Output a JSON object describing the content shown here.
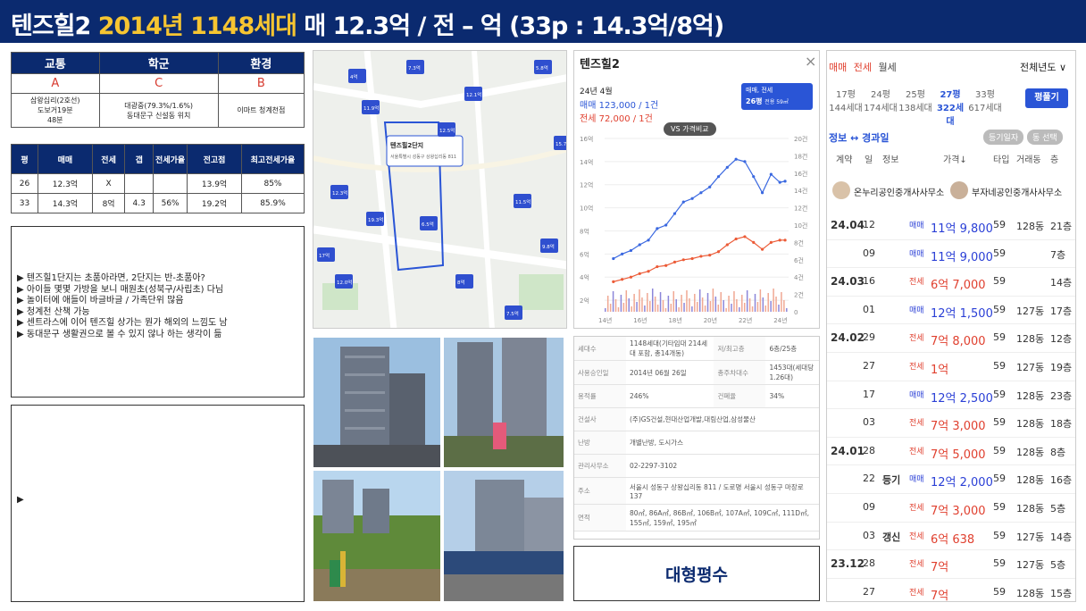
{
  "header": {
    "name": "텐즈힐2",
    "year_units": "2014년 1148세대",
    "rest": "매 12.3억 / 전 – 억 (33p : 14.3억/8억)"
  },
  "env_table": {
    "headers": [
      "교통",
      "학군",
      "환경"
    ],
    "grades": [
      "A",
      "C",
      "B"
    ],
    "details": [
      [
        "삼왕십리(2호선)",
        "도보거19분",
        "48분"
      ],
      [
        "대광중(79.3%/1.6%)",
        "동대문구 신설동 위치"
      ],
      [
        "이마트 청계천점"
      ]
    ]
  },
  "price_table": {
    "headers": [
      "평",
      "매매",
      "전세",
      "갭",
      "전세가율",
      "전고점",
      "최고전세가율"
    ],
    "rows": [
      [
        "26",
        "12.3억",
        "X",
        "",
        "",
        "13.9억",
        "85%"
      ],
      [
        "33",
        "14.3억",
        "8억",
        "4.3",
        "56%",
        "19.2억",
        "85.9%"
      ]
    ]
  },
  "notes": [
    "▶ 텐즈힐1단지는 초품아라면, 2단지는 반-초품아?",
    "▶ 아이들 몇몇 가방을 보니 매원초(성북구/사립초) 다님",
    "▶ 놀이터에 애들이 바글바글 / 가족단위 많음",
    "▶ 청계천 산책 가능",
    "▶ 센트라스에 이어 텐즈힐 상가는 뭔가 해외의 느낌도 남",
    "▶ 동대문구 생활권으로 볼 수 있지 않나 하는 생각이 듦"
  ],
  "notes2": [
    "▶"
  ],
  "map": {
    "popup_title": "텐즈힐2단지",
    "popup_sub": "서울특별시 성동구 상왕십리동 811",
    "pin_labels": [
      "7.3억",
      "5.8억",
      "12.1억",
      "11.9억",
      "12.5억",
      "15.7억",
      "12.3억",
      "11.5억",
      "19.3억",
      "6.5억",
      "9.8억",
      "12.0억",
      "8억",
      "7.5억",
      "4억",
      "17억"
    ]
  },
  "chart_panel": {
    "title": "텐즈힐2",
    "close": "×",
    "date": "24년 4월",
    "sale": "매매 123,000 / 1건",
    "jeonse": "전세 72,000 / 1건",
    "dropdown": "매매, 전세",
    "size": "26평",
    "size_sub": "전용 59㎡",
    "compare": "VS 가격비교"
  },
  "chart_data": {
    "type": "line",
    "x_ticks": [
      "14년",
      "16년",
      "18년",
      "20년",
      "22년",
      "24년"
    ],
    "y_ticks_left": [
      "16억",
      "14억",
      "12억",
      "10억",
      "8억",
      "6억",
      "4억",
      "2억"
    ],
    "y_ticks_right": [
      "20건",
      "18건",
      "16건",
      "14건",
      "12건",
      "10건",
      "8건",
      "6건",
      "4건",
      "2건",
      "0"
    ],
    "series": [
      {
        "name": "매매",
        "x": [
          2014.5,
          2015,
          2015.5,
          2016,
          2016.5,
          2017,
          2017.5,
          2018,
          2018.5,
          2019,
          2019.5,
          2020,
          2020.5,
          2021,
          2021.5,
          2022,
          2022.5,
          2023,
          2023.5,
          2024,
          2024.3
        ],
        "values": [
          5.6,
          6.0,
          6.3,
          6.8,
          7.2,
          8.2,
          8.5,
          9.5,
          10.5,
          10.8,
          11.3,
          11.8,
          12.7,
          13.5,
          14.2,
          14.0,
          12.7,
          11.3,
          12.9,
          12.2,
          12.3
        ]
      },
      {
        "name": "전세",
        "x": [
          2014.5,
          2015,
          2015.5,
          2016,
          2016.5,
          2017,
          2017.5,
          2018,
          2018.5,
          2019,
          2019.5,
          2020,
          2020.5,
          2021,
          2021.5,
          2022,
          2022.5,
          2023,
          2023.5,
          2024,
          2024.3
        ],
        "values": [
          3.6,
          3.8,
          4.0,
          4.3,
          4.5,
          4.9,
          5.0,
          5.3,
          5.5,
          5.6,
          5.8,
          5.9,
          6.2,
          6.8,
          7.3,
          7.5,
          7.0,
          6.4,
          7.0,
          7.2,
          7.2
        ]
      }
    ]
  },
  "info": [
    [
      "세대수",
      "1148세대(기타임대 214세대 포함, 총14개동)",
      "저/최고층",
      "6층/25층"
    ],
    [
      "사용승인일",
      "2014년 06월 26일",
      "총주차대수",
      "1453대(세대당 1.26대)"
    ],
    [
      "용적률",
      "246%",
      "건폐율",
      "34%"
    ],
    [
      "건설사",
      "(주)GS건설,현대산업개발,대림산업,삼성물산",
      "",
      ""
    ],
    [
      "난방",
      "개별난방, 도시가스",
      "",
      ""
    ],
    [
      "관리사무소",
      "02-2297-3102",
      "",
      ""
    ],
    [
      "주소",
      "서울시 성동구 상왕십리동 811 / 도로명 서울시 성동구 마장로 137",
      "",
      ""
    ],
    [
      "면적",
      "80㎡, 86A㎡, 86B㎡, 106B㎡, 107A㎡, 109C㎡, 111D㎡, 155㎡, 159㎡, 195㎡",
      "",
      ""
    ]
  ],
  "big_label": "대형평수",
  "deals": {
    "tabs": [
      "매매",
      "전세",
      "월세"
    ],
    "period": "전체년도 ∨",
    "sizes": [
      [
        "17평",
        "144세대"
      ],
      [
        "24평",
        "174세대"
      ],
      [
        "25평",
        "138세대"
      ],
      [
        "27평",
        "322세대"
      ],
      [
        "33평",
        "617세대"
      ]
    ],
    "compare_btn": "평풀기",
    "sub_tabs": [
      "정보 ↔ 경과일"
    ],
    "badges": [
      "등기일자",
      "동 선택"
    ],
    "col_heads": [
      "계약",
      "일",
      "정보",
      "가격↓",
      "타입",
      "거래동",
      "층"
    ],
    "agents": [
      "온누리공인중개사사무소",
      "부자네공인중개사사무소"
    ],
    "rows": [
      [
        "24.04",
        "12",
        "",
        "매매",
        "11억 9,800",
        "59",
        "128동",
        "21층"
      ],
      [
        "",
        "09",
        "",
        "매매",
        "11억 9,000",
        "59",
        "",
        "7층"
      ],
      [
        "24.03",
        "16",
        "",
        "전세",
        "6억 7,000",
        "59",
        "",
        "14층"
      ],
      [
        "",
        "01",
        "",
        "매매",
        "12억 1,500",
        "59",
        "127동",
        "17층"
      ],
      [
        "24.02",
        "29",
        "",
        "전세",
        "7억 8,000",
        "59",
        "128동",
        "12층"
      ],
      [
        "",
        "27",
        "",
        "전세",
        "1억",
        "59",
        "127동",
        "19층"
      ],
      [
        "",
        "17",
        "",
        "매매",
        "12억 2,500",
        "59",
        "128동",
        "23층"
      ],
      [
        "",
        "03",
        "",
        "전세",
        "7억 3,000",
        "59",
        "128동",
        "18층"
      ],
      [
        "24.01",
        "28",
        "",
        "전세",
        "7억 5,000",
        "59",
        "128동",
        "8층"
      ],
      [
        "",
        "22",
        "등기",
        "매매",
        "12억 2,000",
        "59",
        "128동",
        "16층"
      ],
      [
        "",
        "09",
        "",
        "전세",
        "7억 3,000",
        "59",
        "128동",
        "5층"
      ],
      [
        "",
        "03",
        "갱신",
        "전세",
        "6억 638",
        "59",
        "127동",
        "14층"
      ],
      [
        "23.12",
        "28",
        "",
        "전세",
        "7억",
        "59",
        "127동",
        "5층"
      ],
      [
        "",
        "27",
        "",
        "전세",
        "7억",
        "59",
        "128동",
        "15층"
      ]
    ]
  }
}
